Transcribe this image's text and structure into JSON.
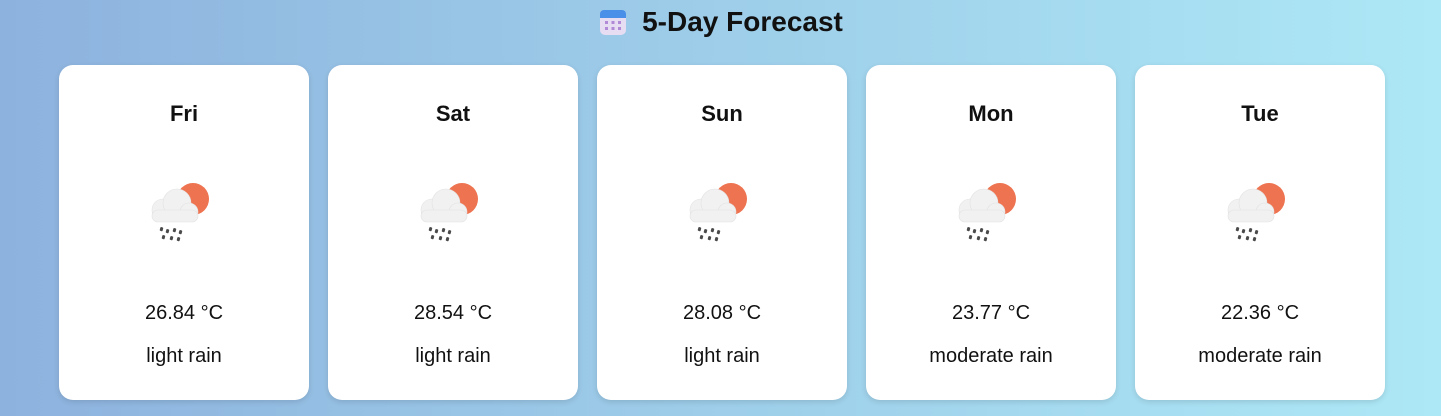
{
  "header": {
    "title": "5-Day Forecast",
    "icon": "calendar-icon"
  },
  "forecast": [
    {
      "day": "Fri",
      "temp": "26.84 °C",
      "description": "light rain",
      "icon": "sun-cloud-rain-icon"
    },
    {
      "day": "Sat",
      "temp": "28.54 °C",
      "description": "light rain",
      "icon": "sun-cloud-rain-icon"
    },
    {
      "day": "Sun",
      "temp": "28.08 °C",
      "description": "light rain",
      "icon": "sun-cloud-rain-icon"
    },
    {
      "day": "Mon",
      "temp": "23.77 °C",
      "description": "moderate rain",
      "icon": "sun-cloud-rain-icon"
    },
    {
      "day": "Tue",
      "temp": "22.36 °C",
      "description": "moderate rain",
      "icon": "sun-cloud-rain-icon"
    }
  ],
  "colors": {
    "sun": "#ee7350",
    "cloud": "#f1f1f1",
    "rain": "#4a4a4a",
    "card_bg": "#ffffff",
    "calendar_accent": "#4a8fe8"
  }
}
